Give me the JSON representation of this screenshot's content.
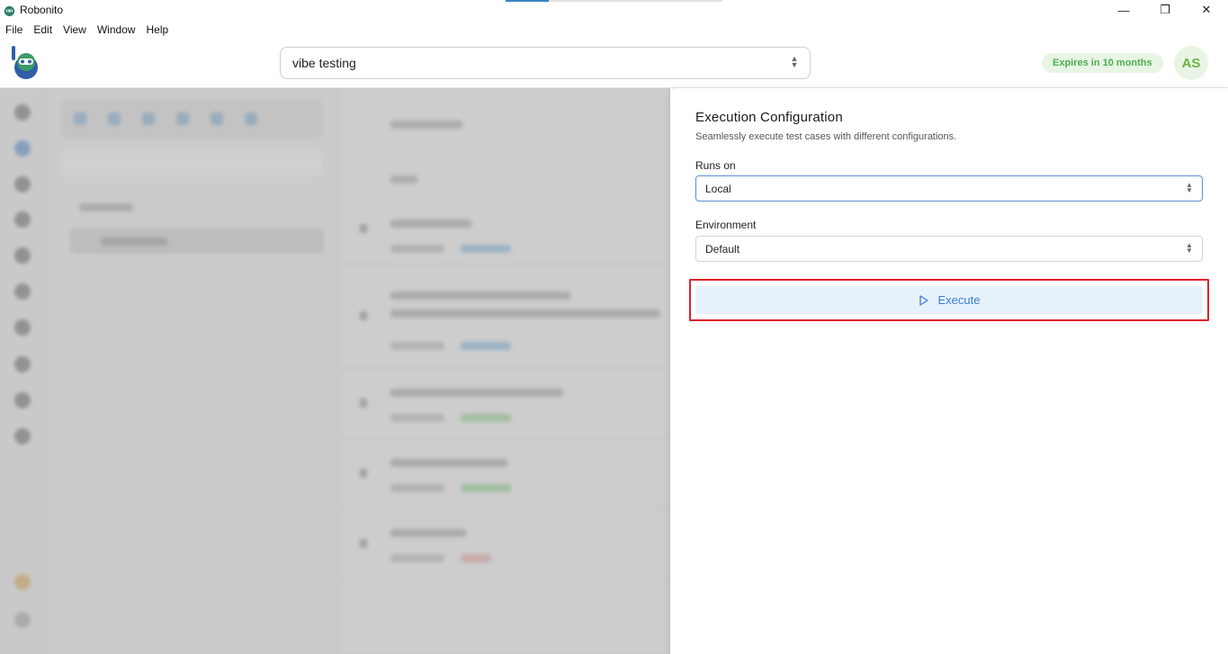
{
  "window": {
    "title": "Robonito",
    "controls": {
      "minimize": "—",
      "maximize": "❐",
      "close": "✕"
    }
  },
  "menu": [
    "File",
    "Edit",
    "View",
    "Window",
    "Help"
  ],
  "header": {
    "project_select_value": "vibe testing",
    "expires_badge": "Expires in 10 months",
    "avatar_initials": "AS"
  },
  "drawer": {
    "title": "Execution Configuration",
    "subtitle": "Seamlessly execute test cases with different configurations.",
    "runs_on": {
      "label": "Runs on",
      "value": "Local"
    },
    "environment": {
      "label": "Environment",
      "value": "Default"
    },
    "execute_label": "Execute"
  },
  "colors": {
    "accent": "#3a7bd5",
    "badge_green": "#4caf50",
    "highlight_red": "#e0202a"
  }
}
